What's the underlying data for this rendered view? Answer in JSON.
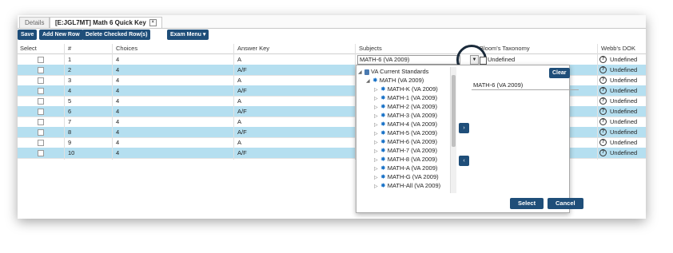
{
  "tabs": [
    {
      "label": "Details"
    },
    {
      "label": "[E:JGL7MT] Math 6 Quick Key",
      "close": "×"
    }
  ],
  "toolbar": {
    "save": "Save",
    "add_row": "Add New Row",
    "delete_rows": "Delete Checked Row(s)",
    "exam_menu": "Exam Menu ▾"
  },
  "table": {
    "headers": {
      "select": "Select",
      "num": "#",
      "choices": "Choices",
      "answer_key": "Answer Key",
      "subjects": "Subjects",
      "bloom": "Bloom's Taxonomy",
      "webb": "Webb's DOK"
    },
    "rows": [
      {
        "num": "1",
        "choices": "4",
        "answer": "A",
        "webb": "Undefined"
      },
      {
        "num": "2",
        "choices": "4",
        "answer": "A/F",
        "webb": "Undefined"
      },
      {
        "num": "3",
        "choices": "4",
        "answer": "A",
        "webb": "Undefined"
      },
      {
        "num": "4",
        "choices": "4",
        "answer": "A/F",
        "webb": "Undefined"
      },
      {
        "num": "5",
        "choices": "4",
        "answer": "A",
        "webb": "Undefined"
      },
      {
        "num": "6",
        "choices": "4",
        "answer": "A/F",
        "webb": "Undefined"
      },
      {
        "num": "7",
        "choices": "4",
        "answer": "A",
        "webb": "Undefined"
      },
      {
        "num": "8",
        "choices": "4",
        "answer": "A/F",
        "webb": "Undefined"
      },
      {
        "num": "9",
        "choices": "4",
        "answer": "A",
        "webb": "Undefined"
      },
      {
        "num": "10",
        "choices": "4",
        "answer": "A/F",
        "webb": "Undefined"
      }
    ]
  },
  "subjects_dropdown": {
    "value": "MATH-6 (VA 2009)",
    "bloom_value": "Undefined",
    "tree": {
      "root": "VA Current Standards",
      "group": "MATH (VA 2009)",
      "items": [
        "MATH-K (VA 2009)",
        "MATH-1 (VA 2009)",
        "MATH-2 (VA 2009)",
        "MATH-3 (VA 2009)",
        "MATH-4 (VA 2009)",
        "MATH-5 (VA 2009)",
        "MATH-6 (VA 2009)",
        "MATH-7 (VA 2009)",
        "MATH-8 (VA 2009)",
        "MATH-A (VA 2009)",
        "MATH-G (VA 2009)",
        "MATH-All (VA 2009)"
      ]
    },
    "clear": "Clear",
    "selected": "MATH-6 (VA 2009)",
    "select": "Select",
    "cancel": "Cancel"
  },
  "colors": {
    "accent": "#1f4e79",
    "row_alt": "#b5dff0"
  }
}
